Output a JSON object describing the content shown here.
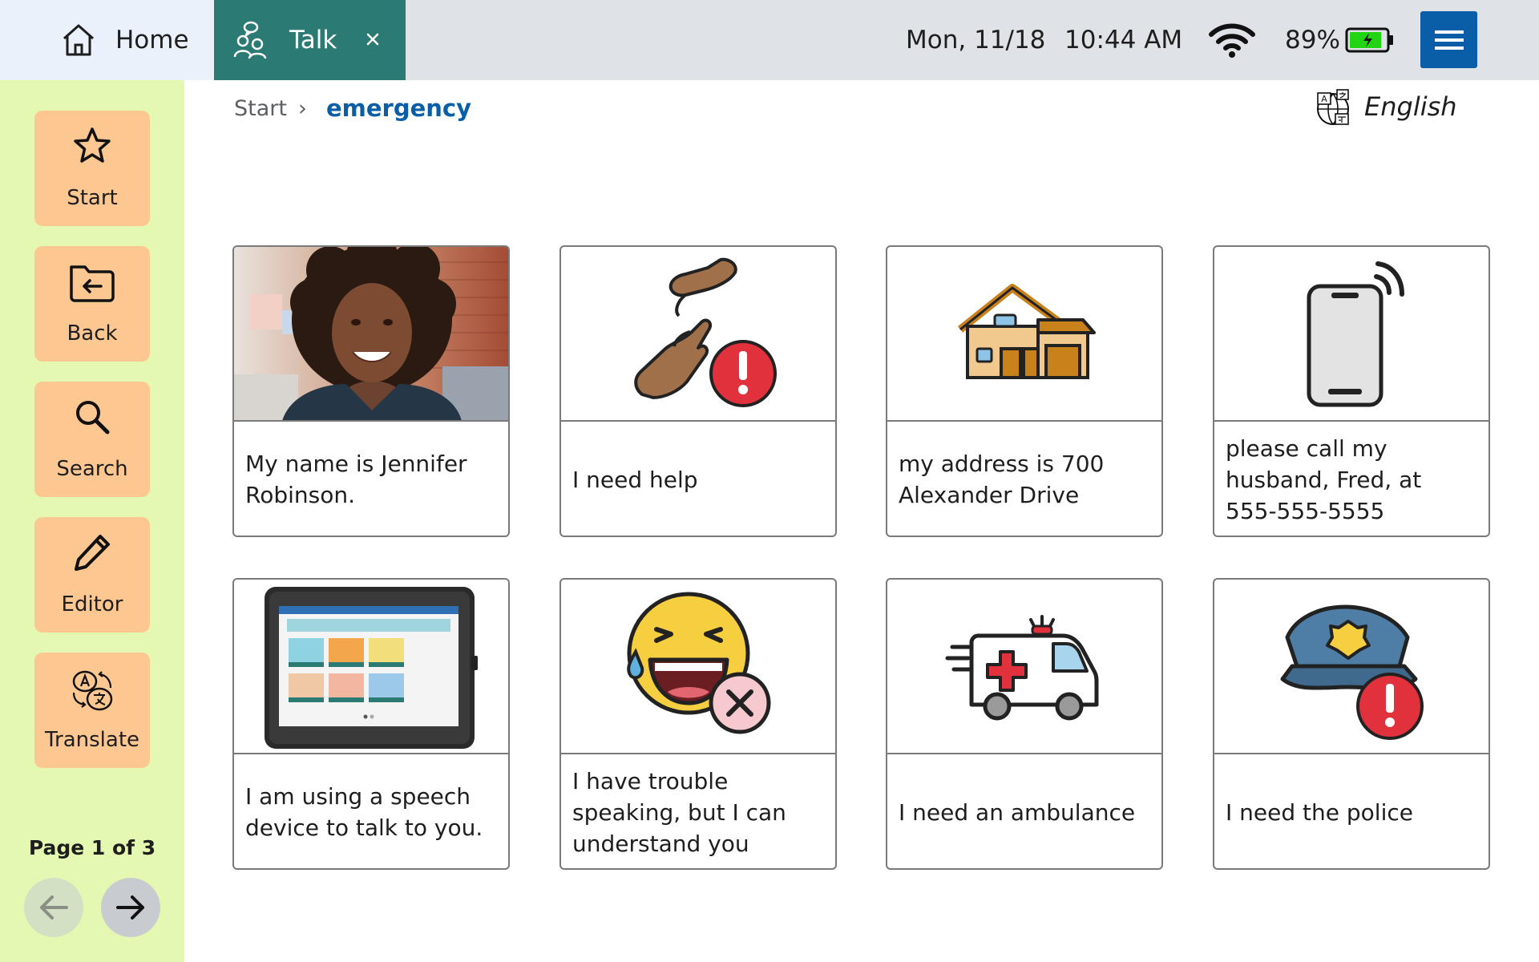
{
  "tabs": {
    "home_label": "Home",
    "talk_label": "Talk"
  },
  "status": {
    "date": "Mon,  11/18",
    "time": "10:44 AM",
    "battery": "89%",
    "battery_level": 0.89,
    "battery_color": "#22d412"
  },
  "colors": {
    "sidebar_bg": "#e4f8b2",
    "button_bg": "#fdc792",
    "talk_tab": "#2c7a74",
    "accent_blue": "#0a5ea8"
  },
  "sidebar": {
    "items": [
      {
        "label": "Start",
        "icon": "star-icon"
      },
      {
        "label": "Back",
        "icon": "folder-back-icon"
      },
      {
        "label": "Search",
        "icon": "search-icon"
      },
      {
        "label": "Editor",
        "icon": "pencil-icon"
      },
      {
        "label": "Translate",
        "icon": "translate-icon"
      }
    ],
    "page_indicator": "Page 1 of 3"
  },
  "breadcrumb": {
    "start": "Start",
    "separator": "›",
    "current": "emergency"
  },
  "language": "English",
  "tiles": [
    {
      "label": "My name is Jennifer Robinson.",
      "image": "woman-portrait-photo"
    },
    {
      "label": "I need help",
      "image": "helping-hands-alert-icon"
    },
    {
      "label": "my address is 700 Alexander Drive",
      "image": "house-icon"
    },
    {
      "label": "please call my husband, Fred, at 555-555-5555",
      "image": "phone-ringing-icon"
    },
    {
      "label": "I am using a speech device to talk to you.",
      "image": "speech-device-photo"
    },
    {
      "label": "I have trouble speaking, but I can understand you",
      "image": "laughing-face-no-icon"
    },
    {
      "label": "I need an ambulance",
      "image": "ambulance-icon"
    },
    {
      "label": "I need the police",
      "image": "police-cap-alert-icon"
    }
  ]
}
